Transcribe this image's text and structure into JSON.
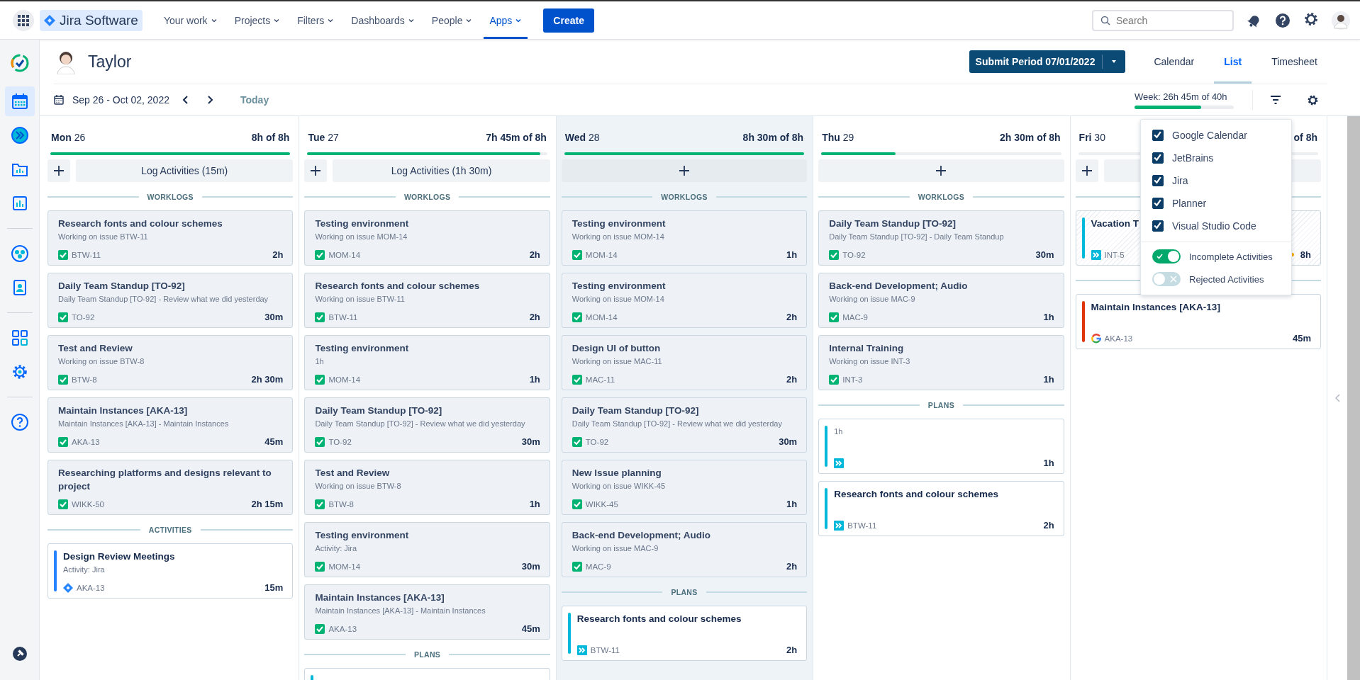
{
  "topbar": {
    "logo": "Jira Software",
    "nav": [
      {
        "label": "Your work",
        "selected": false
      },
      {
        "label": "Projects",
        "selected": false
      },
      {
        "label": "Filters",
        "selected": false
      },
      {
        "label": "Dashboards",
        "selected": false
      },
      {
        "label": "People",
        "selected": false
      },
      {
        "label": "Apps",
        "selected": true
      }
    ],
    "create": "Create",
    "search": {
      "placeholder": "Search"
    }
  },
  "sidebar": {
    "items": [
      {
        "selected": false
      },
      {
        "selected": true
      },
      {
        "selected": false
      },
      {
        "selected": false
      },
      {
        "selected": false
      },
      {
        "selected": false
      },
      {
        "selected": false
      },
      {
        "selected": false
      },
      {
        "selected": false
      },
      {
        "selected": false
      },
      {
        "selected": false
      }
    ]
  },
  "header": {
    "user": "Taylor",
    "submit": "Submit Period 07/01/2022",
    "views": [
      {
        "label": "Calendar",
        "selected": false
      },
      {
        "label": "List",
        "selected": true
      },
      {
        "label": "Timesheet",
        "selected": false
      }
    ],
    "range": "Sep 26 - Oct 02, 2022",
    "today": "Today",
    "week": {
      "label": "Week: 26h 45m of 40h",
      "level": 0.67
    }
  },
  "days": [
    {
      "name": "Mon",
      "date": "26",
      "total": "8h of 8h",
      "level": 1,
      "today": false,
      "add": {
        "kind": "split",
        "label": "Log Activities (15m)"
      },
      "sections": [
        {
          "heading": "WORKLOGS",
          "cards": [
            {
              "kind": "worklog",
              "title": "Research fonts and colour schemes",
              "subtitle": "Working on issue BTW-11",
              "key": "BTW-11",
              "duration": "2h"
            },
            {
              "kind": "worklog",
              "title": "Daily Team Standup [TO-92]",
              "subtitle": "Daily Team Standup [TO-92] - Review what we did yesterday",
              "key": "TO-92",
              "duration": "30m"
            },
            {
              "kind": "worklog",
              "title": "Test and Review",
              "subtitle": "Working on issue BTW-8",
              "key": "BTW-8",
              "duration": "2h 30m"
            },
            {
              "kind": "worklog",
              "title": "Maintain Instances [AKA-13]",
              "subtitle": "Maintain Instances [AKA-13] - Maintain Instances",
              "key": "AKA-13",
              "duration": "45m"
            },
            {
              "kind": "worklog",
              "title": "Researching platforms and designs relevant to project",
              "key": "WIKK-50",
              "duration": "2h 15m"
            }
          ]
        },
        {
          "heading": "ACTIVITIES",
          "cards": [
            {
              "kind": "activity",
              "title": "Design Review Meetings",
              "subtitle": "Activity: Jira",
              "key": "AKA-13",
              "duration": "15m",
              "color": "#2684ff"
            }
          ]
        }
      ]
    },
    {
      "name": "Tue",
      "date": "27",
      "total": "7h 45m of 8h",
      "level": 0.97,
      "today": false,
      "add": {
        "kind": "split",
        "label": "Log Activities (1h 30m)"
      },
      "sections": [
        {
          "heading": "WORKLOGS",
          "cards": [
            {
              "kind": "worklog",
              "title": "Testing environment",
              "subtitle": "Working on issue MOM-14",
              "key": "MOM-14",
              "duration": "2h"
            },
            {
              "kind": "worklog",
              "title": "Research fonts and colour schemes",
              "subtitle": "Working on issue BTW-11",
              "key": "BTW-11",
              "duration": "2h"
            },
            {
              "kind": "worklog",
              "title": "Testing environment",
              "subtitle": "1h",
              "key": "MOM-14",
              "duration": "1h"
            },
            {
              "kind": "worklog",
              "title": "Daily Team Standup [TO-92]",
              "subtitle": "Daily Team Standup [TO-92] - Review what we did yesterday",
              "key": "TO-92",
              "duration": "30m"
            },
            {
              "kind": "worklog",
              "title": "Test and Review",
              "subtitle": "Working on issue BTW-8",
              "key": "BTW-8",
              "duration": "1h"
            },
            {
              "kind": "worklog",
              "title": "Testing environment",
              "subtitle": "Activity: Jira",
              "key": "MOM-14",
              "duration": "30m"
            },
            {
              "kind": "worklog",
              "title": "Maintain Instances [AKA-13]",
              "subtitle": "Maintain Instances [AKA-13] - Maintain Instances",
              "key": "AKA-13",
              "duration": "45m"
            }
          ]
        },
        {
          "heading": "PLANS",
          "cards": [
            {
              "kind": "plan",
              "color": "#00b8d9"
            }
          ]
        }
      ]
    },
    {
      "name": "Wed",
      "date": "28",
      "total": "8h 30m of 8h",
      "level": 1,
      "today": true,
      "add": {
        "kind": "wide"
      },
      "sections": [
        {
          "heading": "WORKLOGS",
          "cards": [
            {
              "kind": "worklog",
              "title": "Testing environment",
              "subtitle": "Working on issue MOM-14",
              "key": "MOM-14",
              "duration": "1h"
            },
            {
              "kind": "worklog",
              "title": "Testing environment",
              "subtitle": "Working on issue MOM-14",
              "key": "MOM-14",
              "duration": "2h"
            },
            {
              "kind": "worklog",
              "title": "Design UI of button",
              "subtitle": "Working on issue MAC-11",
              "key": "MAC-11",
              "duration": "2h"
            },
            {
              "kind": "worklog",
              "title": "Daily Team Standup [TO-92]",
              "subtitle": "Daily Team Standup [TO-92] - Review what we did yesterday",
              "key": "TO-92",
              "duration": "30m"
            },
            {
              "kind": "worklog",
              "title": "New Issue planning",
              "subtitle": "Working on issue WIKK-45",
              "key": "WIKK-45",
              "duration": "1h"
            },
            {
              "kind": "worklog",
              "title": "Back-end Development; Audio",
              "subtitle": "Working on issue MAC-9",
              "key": "MAC-9",
              "duration": "2h"
            }
          ]
        },
        {
          "heading": "PLANS",
          "cards": [
            {
              "kind": "plan",
              "title": "Research fonts and colour schemes",
              "key": "BTW-11",
              "duration": "2h",
              "color": "#00b8d9"
            }
          ]
        }
      ]
    },
    {
      "name": "Thu",
      "date": "29",
      "total": "2h 30m of 8h",
      "level": 0.31,
      "today": false,
      "add": {
        "kind": "wide"
      },
      "sections": [
        {
          "heading": "WORKLOGS",
          "cards": [
            {
              "kind": "worklog",
              "title": "Daily Team Standup [TO-92]",
              "subtitle": "Daily Team Standup [TO-92] - Daily Team Standup",
              "key": "TO-92",
              "duration": "30m"
            },
            {
              "kind": "worklog",
              "title": "Back-end Development; Audio",
              "subtitle": "Working on issue MAC-9",
              "key": "MAC-9",
              "duration": "1h"
            },
            {
              "kind": "worklog",
              "title": "Internal Training",
              "subtitle": "Working on issue INT-3",
              "key": "INT-3",
              "duration": "1h"
            }
          ]
        },
        {
          "heading": "PLANS",
          "cards": [
            {
              "kind": "plan",
              "subtitle": "1h",
              "duration": "1h",
              "color": "#00b8d9"
            },
            {
              "kind": "plan",
              "title": "Research fonts and colour schemes",
              "key": "BTW-11",
              "duration": "2h",
              "color": "#00b8d9"
            }
          ]
        }
      ]
    },
    {
      "name": "Fri",
      "date": "30",
      "total": "of 8h",
      "today": false,
      "add": {
        "kind": "split"
      },
      "sections": [
        {
          "cards": [
            {
              "kind": "plan",
              "title": "Vacation T",
              "key": "INT-5",
              "duration": "8h",
              "color": "#00b8d9",
              "hatched": true,
              "pending": true
            }
          ]
        },
        {
          "cards": [
            {
              "kind": "event",
              "title": "Maintain Instances [AKA-13]",
              "key": "AKA-13",
              "duration": "45m",
              "color": "#de350b"
            }
          ]
        }
      ]
    }
  ],
  "filter_menu": {
    "sources": [
      {
        "label": "Google Calendar",
        "checked": true
      },
      {
        "label": "JetBrains",
        "checked": true
      },
      {
        "label": "Jira",
        "checked": true
      },
      {
        "label": "Planner",
        "checked": true
      },
      {
        "label": "Visual Studio Code",
        "checked": true
      }
    ],
    "toggles": [
      {
        "label": "Incomplete Activities",
        "on": true
      },
      {
        "label": "Rejected Activities",
        "on": false
      }
    ]
  }
}
